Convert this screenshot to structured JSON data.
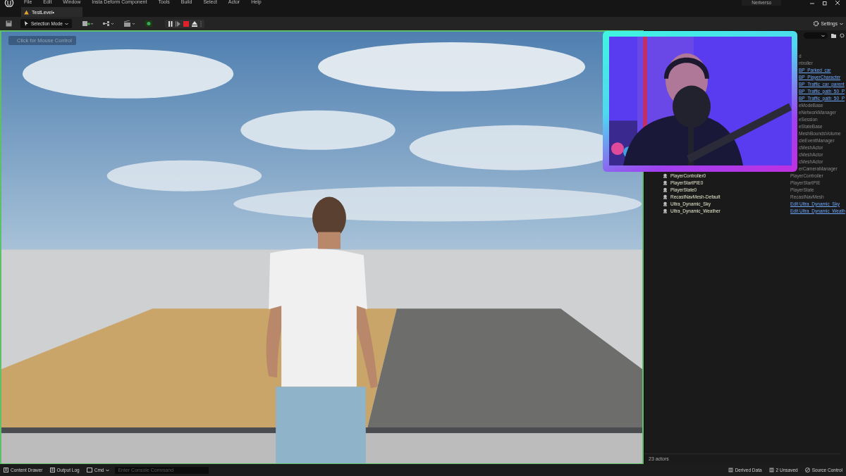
{
  "menu": [
    "File",
    "Edit",
    "Window",
    "Insta Deform Component",
    "Tools",
    "Build",
    "Select",
    "Actor",
    "Help"
  ],
  "user": "Neriverso",
  "tabs": [
    {
      "label": "TestLevel•",
      "selected": true
    }
  ],
  "toolbar": {
    "mode": "Selection Mode",
    "settings": "Settings"
  },
  "viewport": {
    "kind": "picture",
    "hint": "Click for Mouse Control"
  },
  "outliner": {
    "rows": [
      {
        "type": "d",
        "link": false
      },
      {
        "type": "ntroller",
        "link": false
      },
      {
        "type": "BP_Parked_car",
        "link": true
      },
      {
        "type": "BP_PlayerCharacter",
        "link": true
      },
      {
        "type": "BP_Traffic_car_parent",
        "link": true
      },
      {
        "type": "BP_Traffic_path_50_P",
        "link": true
      },
      {
        "type": "BP_Traffic_path_50_P",
        "link": true
      },
      {
        "type": "eModeBase",
        "link": false
      },
      {
        "type": "eNetworkManager",
        "link": false
      },
      {
        "type": "eSession",
        "link": false
      },
      {
        "type": "eStateBase",
        "link": false
      },
      {
        "type": "MeshBoundsVolume",
        "link": false
      },
      {
        "type": "cleEventManager",
        "link": false
      },
      {
        "type": "cMeshActor",
        "link": false
      },
      {
        "type": "cMeshActor",
        "link": false
      },
      {
        "type": "cMeshActor",
        "link": false
      },
      {
        "type": "erCameraManager",
        "link": false
      },
      {
        "name": "PlayerController0",
        "type": "PlayerController",
        "link": false
      },
      {
        "name": "PlayerStartPIE0",
        "type": "PlayerStartPIE",
        "link": false
      },
      {
        "name": "PlayerState0",
        "type": "PlayerState",
        "link": false
      },
      {
        "name": "RecastNavMesh-Default",
        "type": "RecastNavMesh",
        "link": false
      },
      {
        "name": "Ultra_Dynamic_Sky",
        "type": "Edit Ultra_Dynamic_Sky",
        "link": true
      },
      {
        "name": "Ultra_Dynamic_Weather",
        "type": "Edit Ultra_Dynamic_Weath",
        "link": true
      }
    ],
    "count": "23 actors"
  },
  "status_bar": {
    "left": [
      "Content Drawer",
      "Output Log"
    ],
    "cmd": "Cmd",
    "console_placeholder": "Enter Console Command",
    "right": [
      "Derived Data",
      "2 Unsaved",
      "Source Control"
    ]
  }
}
